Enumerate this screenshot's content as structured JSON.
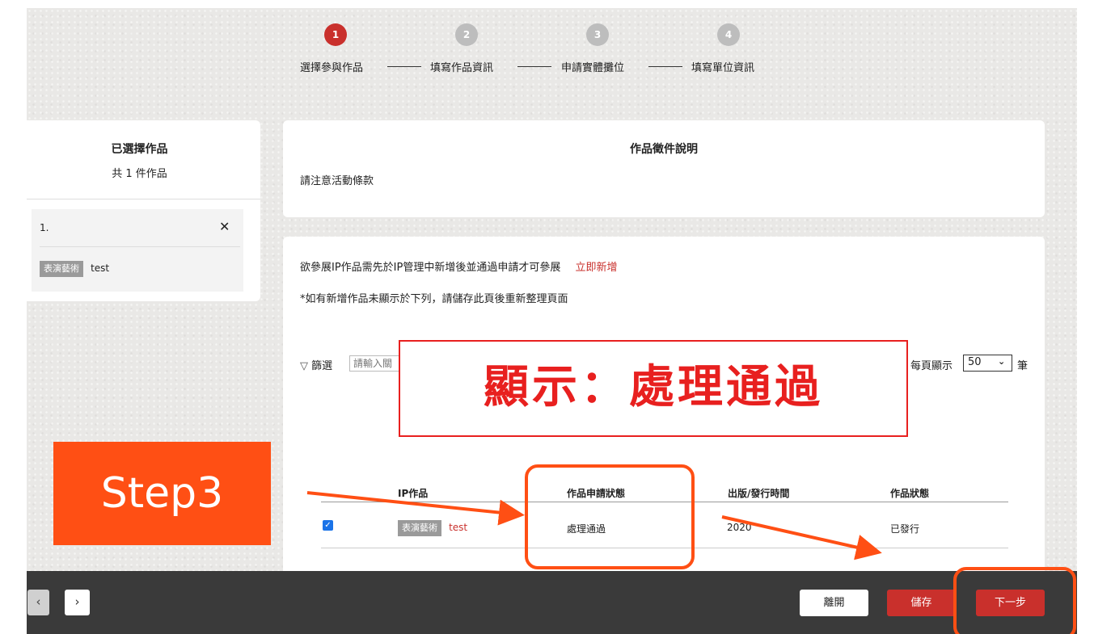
{
  "stepper": {
    "steps": [
      {
        "number": "1",
        "label": "選擇參與作品"
      },
      {
        "number": "2",
        "label": "填寫作品資訊"
      },
      {
        "number": "3",
        "label": "申請實體攤位"
      },
      {
        "number": "4",
        "label": "填寫單位資訊"
      }
    ],
    "active_index": 0
  },
  "selected_panel": {
    "title": "已選擇作品",
    "count_text": "共 1 件作品",
    "items": [
      {
        "index": "1.",
        "tag": "表演藝術",
        "name": "test"
      }
    ],
    "remove_icon": "close-icon"
  },
  "description_card": {
    "title": "作品徵件說明",
    "body": "請注意活動條款"
  },
  "works_card": {
    "notice": "欲參展IP作品需先於IP管理中新增後並通過申請才可參展",
    "add_link": "立即新增",
    "hint": "*如有新增作品未顯示於下列，請儲存此頁後重新整理頁面",
    "filter_label": "篩選",
    "filter_placeholder": "請輸入關",
    "per_page_label": "每頁顯示",
    "per_page_value": "50",
    "per_page_unit": "筆",
    "columns": [
      "IP作品",
      "作品申請狀態",
      "出版/發行時間",
      "作品狀態"
    ],
    "rows": [
      {
        "checked": true,
        "tag": "表演藝術",
        "name": "test",
        "apply_status": "處理通過",
        "date": "2020",
        "work_status": "已發行"
      }
    ]
  },
  "overlays": {
    "callout_text": "顯示：處理通過",
    "step_badge": "Step3",
    "accent_color": "#ff4f14",
    "callout_color": "#e8201f"
  },
  "bottom_bar": {
    "leave": "離開",
    "save": "儲存",
    "next": "下一步"
  },
  "colors": {
    "brand_red": "#c9302c",
    "bar_bg": "#3a3a3a"
  }
}
